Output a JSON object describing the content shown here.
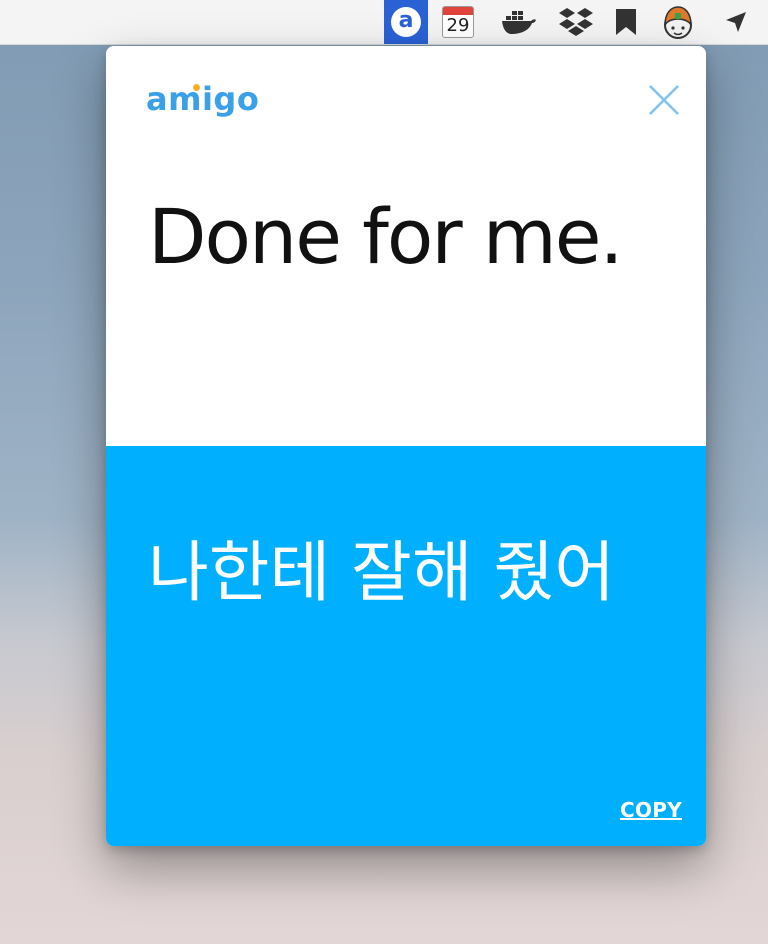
{
  "menubar": {
    "items": [
      {
        "name": "amigo",
        "icon": "amigo-icon",
        "glyph": "a",
        "active": true
      },
      {
        "name": "calendar",
        "icon": "calendar-icon",
        "day": "29"
      },
      {
        "name": "docker",
        "icon": "docker-icon"
      },
      {
        "name": "dropbox",
        "icon": "dropbox-icon"
      },
      {
        "name": "bookmark",
        "icon": "bookmark-icon"
      },
      {
        "name": "avatar",
        "icon": "avatar-icon"
      },
      {
        "name": "location",
        "icon": "location-arrow-icon"
      }
    ],
    "active_color": "#2a62d6"
  },
  "popup": {
    "logo": "amigo",
    "close_icon": "close-icon",
    "source_text": "Done for me.",
    "translation_text": "나한테 잘해 줬어",
    "copy_label": "COPY",
    "colors": {
      "logo": "#3aa0e8",
      "logo_dot": "#f5b027",
      "close": "#82c4f0",
      "translation_bg": "#00b0ff",
      "translation_text": "#ffffff",
      "source_text": "#111111"
    }
  }
}
